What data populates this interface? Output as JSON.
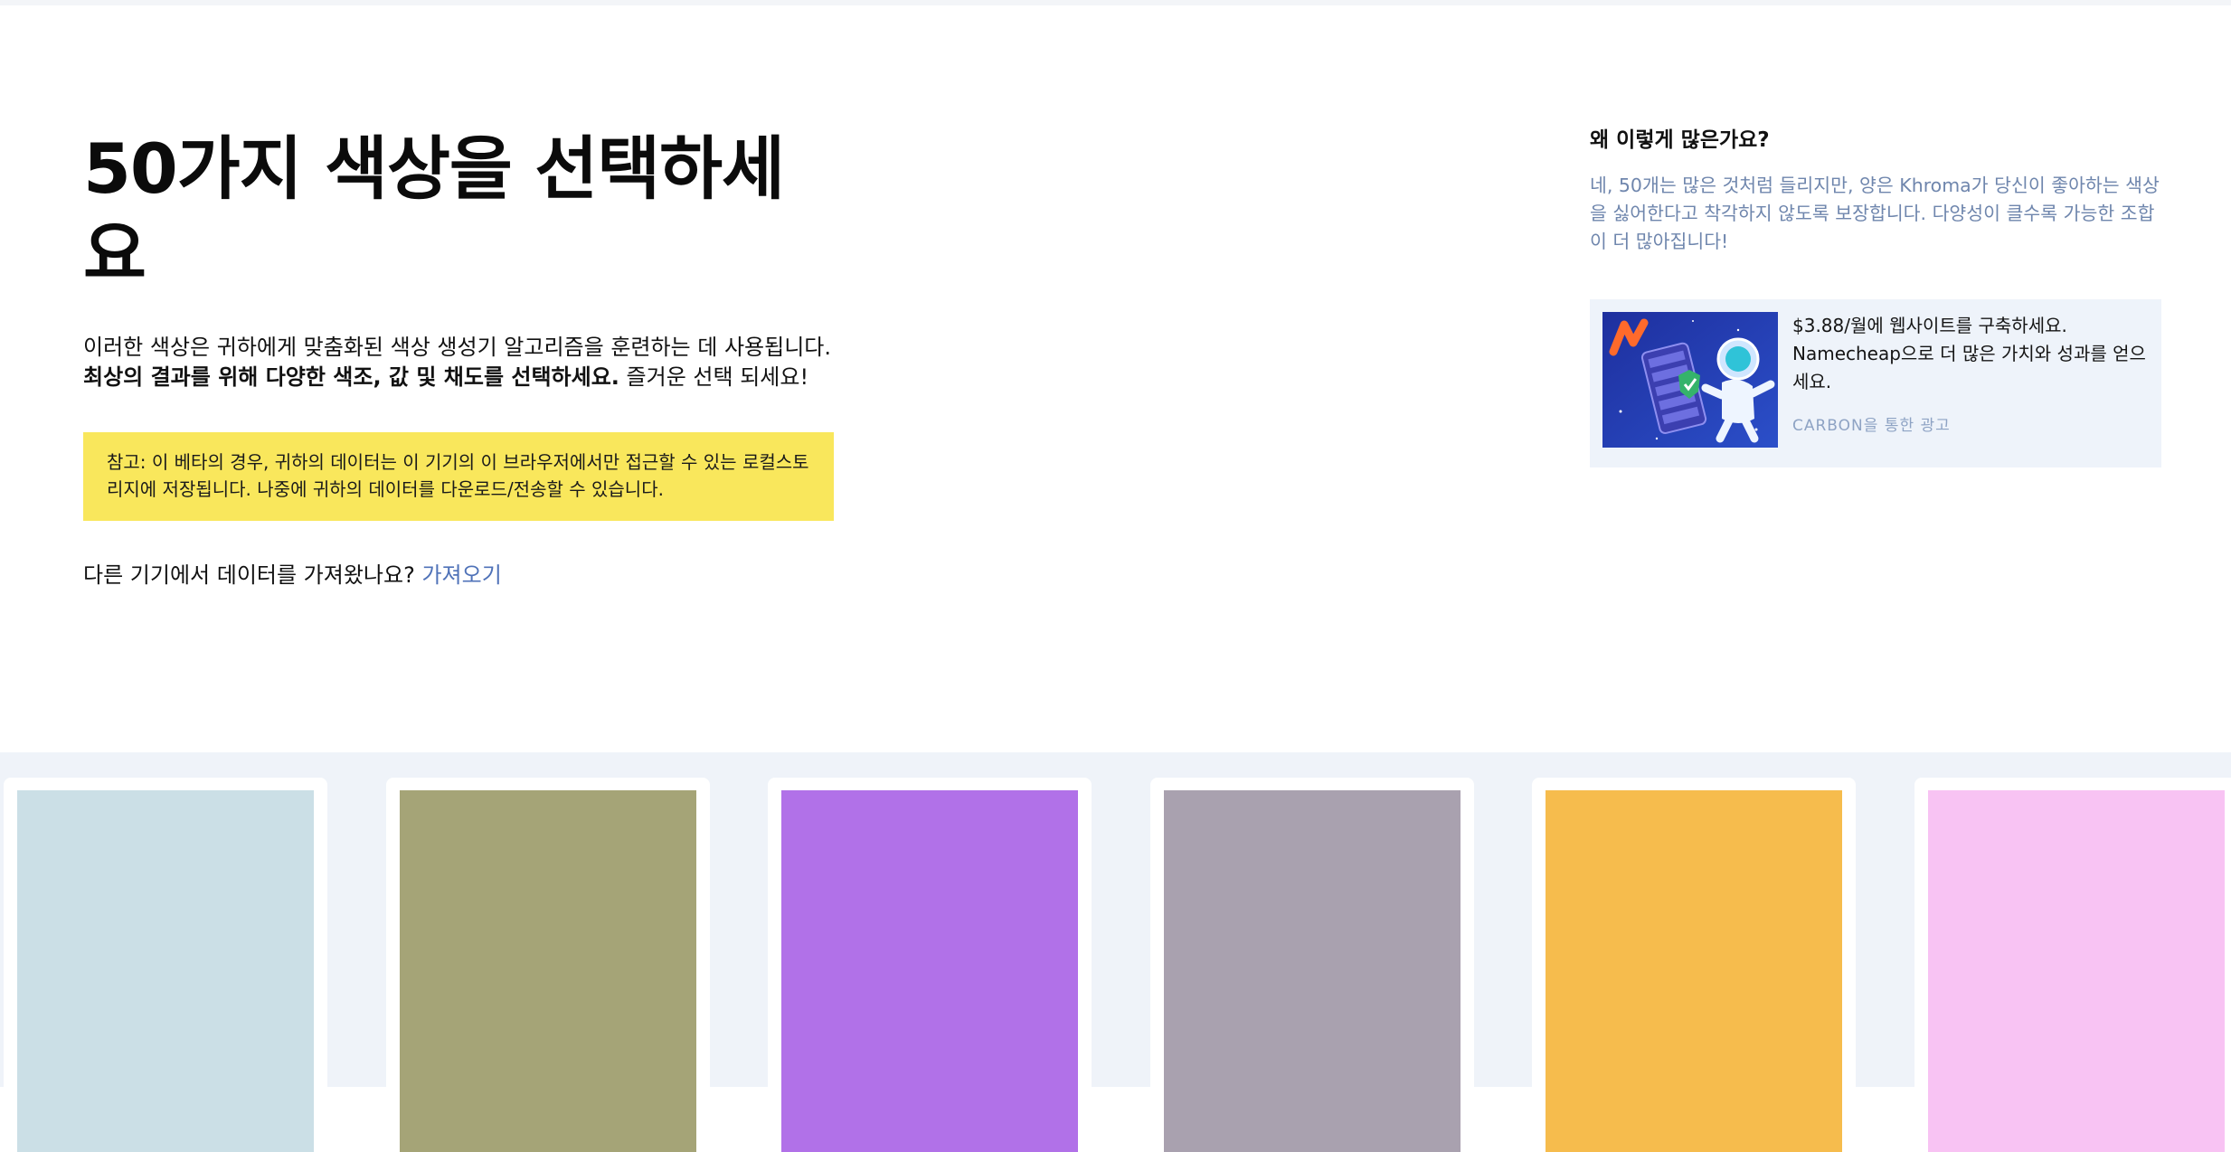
{
  "intro": {
    "title": "50가지 색상을 선택하세요",
    "text_part1": "이러한 색상은 귀하에게 맞춤화된 색상 생성기 알고리즘을 훈련하는 데 사용됩니다. ",
    "text_bold": "최상의 결과를 위해 다양한 색조, 값 및 채도를 선택하세요.",
    "text_part2": " 즐거운 선택 되세요!",
    "note": "참고: 이 베타의 경우, 귀하의 데이터는 이 기기의 이 브라우저에서만 접근할 수 있는 로컬스토리지에 저장됩니다. 나중에 귀하의 데이터를 다운로드/전송할 수 있습니다.",
    "import_prompt": "다른 기기에서 데이터를 가져왔나요? ",
    "import_link": "가져오기"
  },
  "side": {
    "heading": "왜 이렇게 많은가요?",
    "text": "네, 50개는 많은 것처럼 들리지만, 양은 Khroma가 당신이 좋아하는 색상을 싫어한다고 착각하지 않도록 보장합니다. 다양성이 클수록 가능한 조합이 더 많아집니다!",
    "ad": {
      "text": "$3.88/월에 웹사이트를 구축하세요. Namecheap으로 더 많은 가치와 성과를 얻으세요.",
      "via": "CARBON을 통한 광고"
    }
  },
  "swatches": [
    {
      "color": "#cbdfe6"
    },
    {
      "color": "#a5a477"
    },
    {
      "color": "#b171e8"
    },
    {
      "color": "#a9a1af"
    },
    {
      "color": "#f6bc4d"
    },
    {
      "color": "#f8c3f3"
    }
  ],
  "colors": {
    "accent_link": "#4f72b8",
    "note_bg": "#f9e75c",
    "side_text": "#6f86ad",
    "ad_bg": "#eef3fa",
    "swatch_area_bg": "#eff3f9"
  }
}
